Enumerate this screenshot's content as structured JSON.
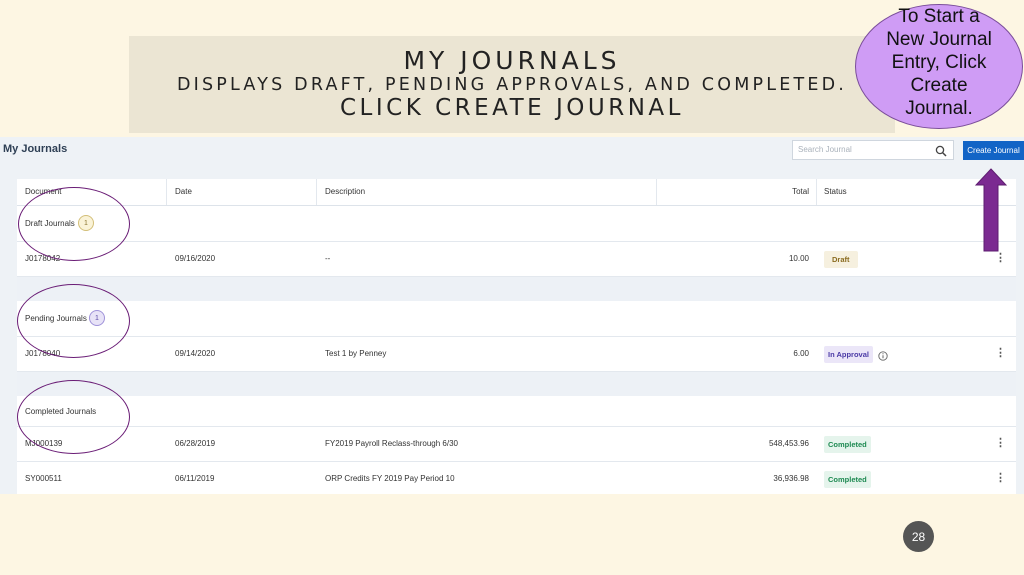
{
  "slide": {
    "title": "MY JOURNALS",
    "subtitle": "DISPLAYS DRAFT, PENDING APPROVALS, AND COMPLETED.",
    "instruction": "CLICK CREATE JOURNAL",
    "callout": "To Start a New Journal Entry, Click Create Journal.",
    "page_number": "28",
    "colors": {
      "callout_fill": "#cf9cf5",
      "annotation": "#6a1d76",
      "arrow": "#7b2a91",
      "background": "#fdf6e3"
    }
  },
  "app": {
    "title": "My Journals",
    "search_placeholder": "Search Journal",
    "search_icon": "search-icon",
    "create_button": "Create Journal",
    "accent": "#1264c6",
    "columns": [
      "Document",
      "Date",
      "Description",
      "Total",
      "Status"
    ],
    "groups": {
      "draft": {
        "label": "Draft Journals",
        "count": "1",
        "rows": [
          {
            "document": "J0178042",
            "date": "09/16/2020",
            "description": "--",
            "total": "10.00",
            "status": "Draft"
          }
        ]
      },
      "pending": {
        "label": "Pending Journals",
        "count": "1",
        "rows": [
          {
            "document": "J0178040",
            "date": "09/14/2020",
            "description": "Test 1 by Penney",
            "total": "6.00",
            "status": "In Approval"
          }
        ]
      },
      "completed": {
        "label": "Completed Journals",
        "rows": [
          {
            "document": "MJ000139",
            "date": "06/28/2019",
            "description": "FY2019 Payroll Reclass-through 6/30",
            "total": "548,453.96",
            "status": "Completed"
          },
          {
            "document": "SY000511",
            "date": "06/11/2019",
            "description": "ORP Credits FY 2019 Pay Period 10",
            "total": "36,936.98",
            "status": "Completed"
          }
        ]
      }
    }
  }
}
